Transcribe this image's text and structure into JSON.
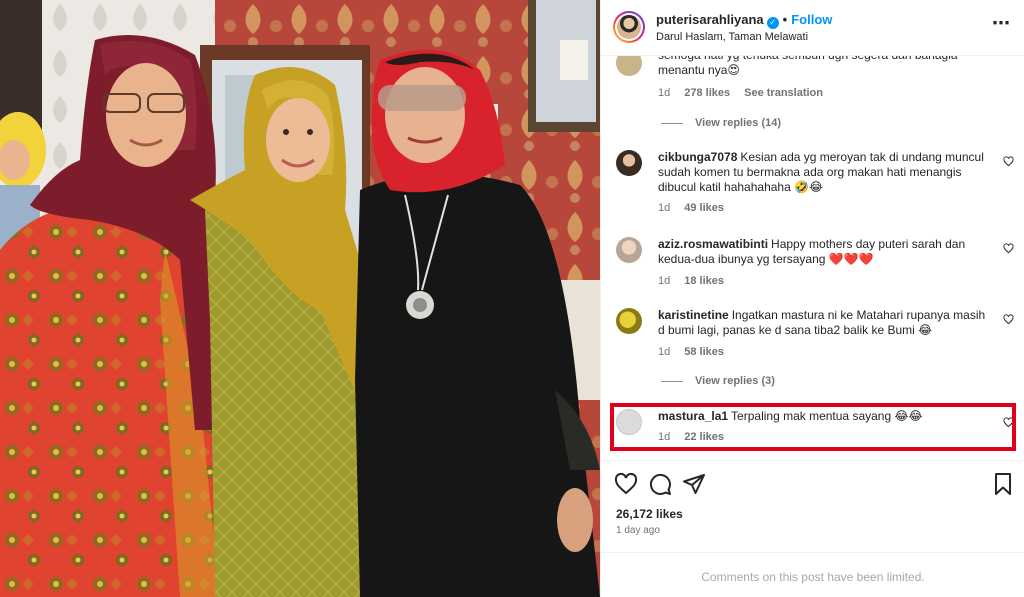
{
  "post": {
    "username": "puterisarahliyana",
    "separator": "•",
    "follow_label": "Follow",
    "location": "Darul Haslam, Taman Melawati",
    "more_icon": "more-horizontal-icon",
    "verified_icon": "verified-badge-icon"
  },
  "comments": [
    {
      "text": "semoga hati yg terluka sembuh dgn segera dan bahagia menantu nya😍",
      "time": "1d",
      "likes": "278 likes",
      "translate": "See translation"
    },
    {
      "username": "cikbunga7078",
      "text": "Kesian ada yg meroyan tak di undang muncul sudah komen tu bermakna ada org makan hati menangis dibucul katil hahahahaha 🤣😂",
      "time": "1d",
      "likes": "49 likes"
    },
    {
      "username": "aziz.rosmawatibinti",
      "text": "Happy mothers day puteri sarah dan kedua-dua ibunya yg tersayang ❤️❤️❤️",
      "time": "1d",
      "likes": "18 likes"
    },
    {
      "username": "karistinetine",
      "text": "Ingatkan mastura ni ke Matahari rupanya masih d bumi lagi, panas ke d sana tiba2 balik ke Bumi 😂",
      "time": "1d",
      "likes": "58 likes"
    },
    {
      "username": "mastura_la1",
      "text": "Terpaling mak mentua sayang 😂😂",
      "time": "1d",
      "likes": "22 likes"
    }
  ],
  "view_replies": [
    "View replies (14)",
    "View replies (3)"
  ],
  "actions": {
    "icons": [
      "heart-icon",
      "comment-icon",
      "share-icon",
      "bookmark-icon"
    ],
    "likes": "26,172 likes",
    "time_ago": "1 day ago"
  },
  "footer": {
    "limited_text": "Comments on this post have been limited."
  },
  "colors": {
    "accent": "#0095f6",
    "highlight": "#e0001b",
    "secondary_text": "#737373"
  }
}
